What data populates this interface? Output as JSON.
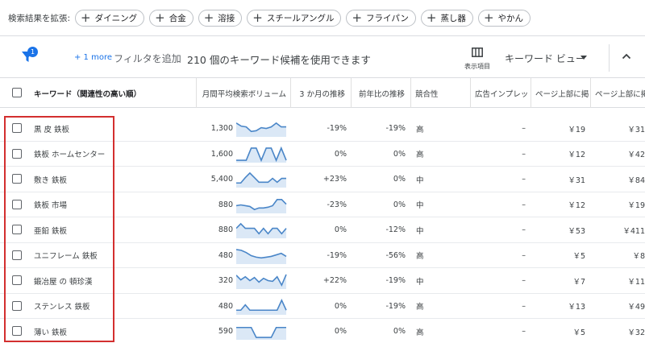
{
  "expand": {
    "label": "検索結果を拡張:",
    "chips": [
      "ダイニング",
      "合金",
      "溶接",
      "スチールアングル",
      "フライパン",
      "蒸し器",
      "やかん"
    ]
  },
  "toolbar": {
    "filter_count": "1",
    "more_link": "+ 1 more",
    "add_filter": "フィルタを追加",
    "available": "210 個のキーワード候補を使用できます",
    "columns_label": "表示項目",
    "keyword_view": "キーワード ビュー"
  },
  "table": {
    "headers": {
      "keyword": "キーワード（関連性の高い順）",
      "volume": "月間平均検索ボリューム",
      "trend3m": "3 か月の推移",
      "yoy": "前年比の推移",
      "competition": "競合性",
      "ad_impr": "広告インプレッ",
      "top_bid_low": "ページ上部に掲",
      "top_bid_high": "ページ上部に掲"
    },
    "rows": [
      {
        "keyword": "黒 皮 鉄板",
        "volume": "1,300",
        "trend": [
          0.85,
          0.65,
          0.6,
          0.3,
          0.35,
          0.55,
          0.5,
          0.6,
          0.85,
          0.6,
          0.6
        ],
        "trend3m": "-19%",
        "yoy": "-19%",
        "competition": "高",
        "ad_impr": "–",
        "bid_low": "￥19",
        "bid_high": "￥31"
      },
      {
        "keyword": "鉄板 ホームセンター",
        "volume": "1,600",
        "trend": [
          0.1,
          0.1,
          0.1,
          0.9,
          0.9,
          0.1,
          0.9,
          0.9,
          0.1,
          0.9,
          0.1
        ],
        "trend3m": "0%",
        "yoy": "0%",
        "competition": "高",
        "ad_impr": "–",
        "bid_low": "￥12",
        "bid_high": "￥42"
      },
      {
        "keyword": "敷き 鉄板",
        "volume": "5,400",
        "trend": [
          0.25,
          0.25,
          0.6,
          0.9,
          0.6,
          0.3,
          0.3,
          0.3,
          0.55,
          0.3,
          0.55,
          0.55
        ],
        "trend3m": "+23%",
        "yoy": "0%",
        "competition": "中",
        "ad_impr": "–",
        "bid_low": "￥31",
        "bid_high": "￥84"
      },
      {
        "keyword": "鉄板 市場",
        "volume": "880",
        "trend": [
          0.45,
          0.5,
          0.45,
          0.4,
          0.2,
          0.3,
          0.3,
          0.35,
          0.45,
          0.85,
          0.85,
          0.55
        ],
        "trend3m": "-23%",
        "yoy": "0%",
        "competition": "中",
        "ad_impr": "–",
        "bid_low": "￥12",
        "bid_high": "￥19"
      },
      {
        "keyword": "亜鉛 鉄板",
        "volume": "880",
        "trend": [
          0.6,
          0.9,
          0.6,
          0.6,
          0.6,
          0.25,
          0.6,
          0.25,
          0.6,
          0.6,
          0.25,
          0.6
        ],
        "trend3m": "0%",
        "yoy": "-12%",
        "competition": "中",
        "ad_impr": "–",
        "bid_low": "￥53",
        "bid_high": "￥411"
      },
      {
        "keyword": "ユニフレーム 鉄板",
        "volume": "480",
        "trend": [
          0.9,
          0.85,
          0.7,
          0.5,
          0.4,
          0.35,
          0.4,
          0.45,
          0.55,
          0.65,
          0.45
        ],
        "trend3m": "-19%",
        "yoy": "-56%",
        "competition": "高",
        "ad_impr": "–",
        "bid_low": "￥5",
        "bid_high": "￥8"
      },
      {
        "keyword": "鍛冶屋 の 頓珍漢",
        "volume": "320",
        "trend": [
          0.85,
          0.55,
          0.75,
          0.5,
          0.7,
          0.4,
          0.65,
          0.5,
          0.45,
          0.75,
          0.2,
          0.9
        ],
        "trend3m": "+22%",
        "yoy": "-19%",
        "competition": "中",
        "ad_impr": "–",
        "bid_low": "￥7",
        "bid_high": "￥11"
      },
      {
        "keyword": "ステンレス 鉄板",
        "volume": "480",
        "trend": [
          0.25,
          0.25,
          0.6,
          0.25,
          0.25,
          0.25,
          0.25,
          0.25,
          0.25,
          0.25,
          0.9,
          0.25
        ],
        "trend3m": "0%",
        "yoy": "-19%",
        "competition": "高",
        "ad_impr": "–",
        "bid_low": "￥13",
        "bid_high": "￥49"
      },
      {
        "keyword": "薄い 鉄板",
        "volume": "590",
        "trend": [
          0.75,
          0.75,
          0.75,
          0.75,
          0.1,
          0.1,
          0.1,
          0.1,
          0.75,
          0.75,
          0.75
        ],
        "trend3m": "0%",
        "yoy": "0%",
        "competition": "高",
        "ad_impr": "–",
        "bid_low": "￥5",
        "bid_high": "￥32"
      }
    ]
  },
  "colors": {
    "accent": "#1a73e8",
    "spark": "#4a86c8",
    "spark_fill": "#dbe8f6",
    "highlight": "#d32f2f"
  }
}
